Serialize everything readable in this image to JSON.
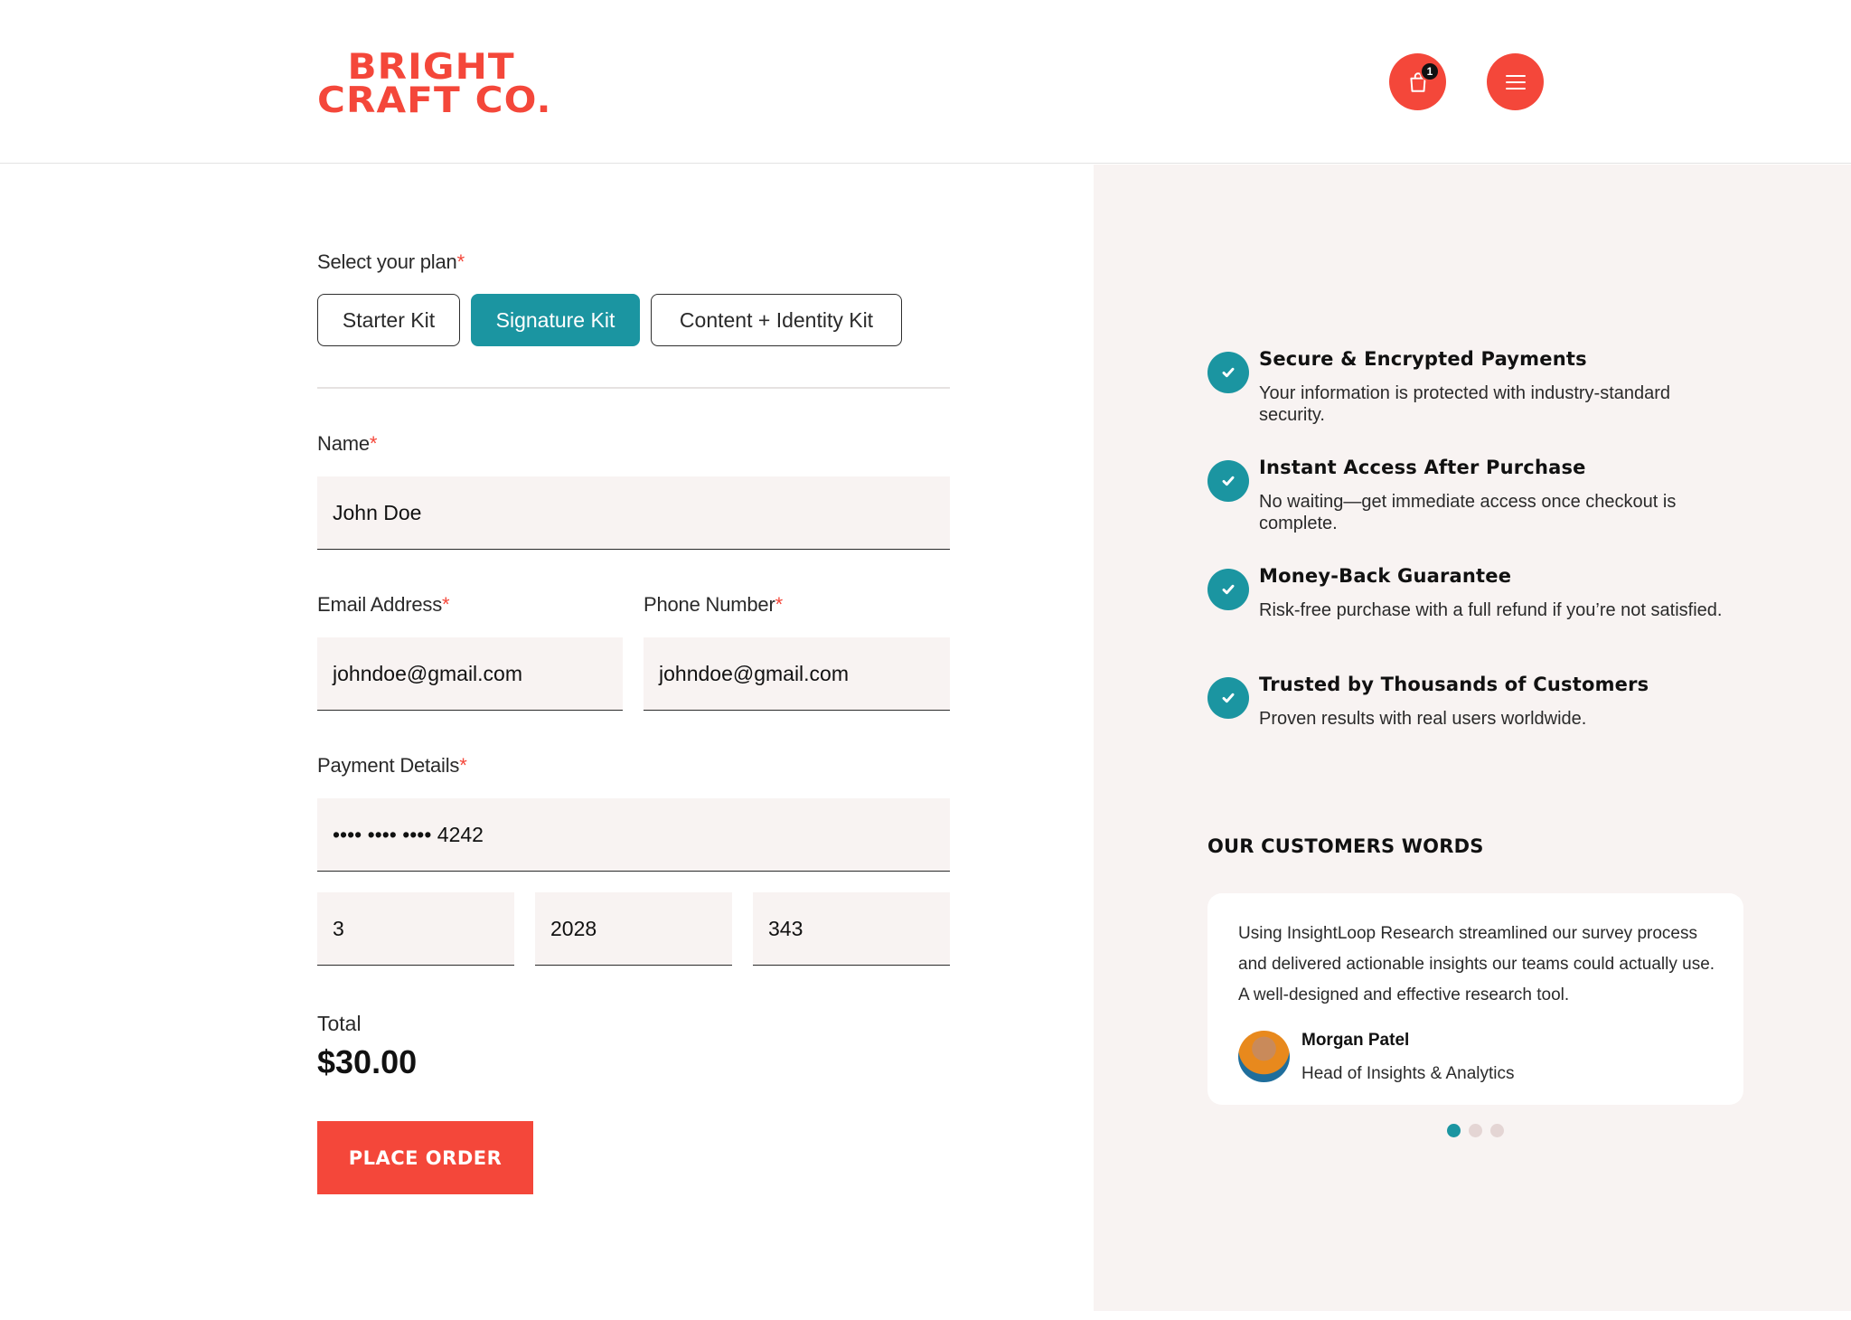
{
  "brand": {
    "line1": "BRIGHT",
    "line2": "CRAFT CO."
  },
  "header": {
    "cart_count": "1",
    "accent_color": "#f4473a"
  },
  "form": {
    "plan_label": "Select your plan",
    "plans": [
      "Starter Kit",
      "Signature Kit",
      "Content + Identity Kit"
    ],
    "selected_plan": "Signature Kit",
    "name_label": "Name",
    "name_value": "John Doe",
    "email_label": "Email Address",
    "email_value": "johndoe@gmail.com",
    "phone_label": "Phone Number",
    "phone_value": "johndoe@gmail.com",
    "payment_label": "Payment Details",
    "card_number": "•••• •••• •••• 4242",
    "exp_month": "3",
    "exp_year": "2028",
    "cvc": "343",
    "required_mark": "*",
    "total_label": "Total",
    "total_value": "$30.00",
    "order_button": "PLACE ORDER"
  },
  "features": [
    {
      "title": "Secure & Encrypted Payments",
      "desc": "Your information is protected with industry-standard security."
    },
    {
      "title": "Instant Access After Purchase",
      "desc": "No waiting—get immediate access once checkout is complete."
    },
    {
      "title": "Money-Back Guarantee",
      "desc": "Risk-free purchase with a full refund if you’re not satisfied."
    },
    {
      "title": "Trusted by Thousands of Customers",
      "desc": "Proven results with real users worldwide."
    }
  ],
  "testimonials": {
    "section_title": "OUR CUSTOMERS WORDS",
    "quote": "Using InsightLoop Research streamlined our survey process and delivered actionable insights our teams could actually use. A well-designed and effective research tool.",
    "author": "Morgan Patel",
    "role": "Head of Insights & Analytics",
    "active_slide": 1,
    "slide_count": 3
  },
  "colors": {
    "accent": "#f4473a",
    "teal": "#1b95a1",
    "panel": "#f8f3f2"
  }
}
